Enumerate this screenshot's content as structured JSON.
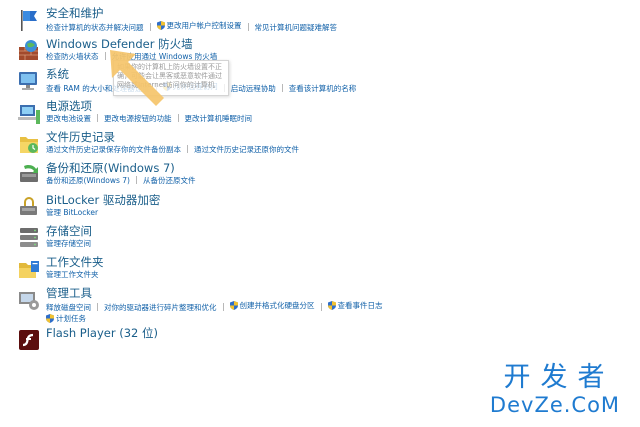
{
  "items": [
    {
      "title": "安全和维护",
      "icon": "flag-icon",
      "links": [
        {
          "label": "检查计算机的状态并解决问题",
          "shield": false
        },
        {
          "label": "更改用户帐户控制设置",
          "shield": true
        },
        {
          "label": "常见计算机问题疑难解答",
          "shield": false
        }
      ]
    },
    {
      "title": "Windows Defender 防火墙",
      "icon": "firewall-icon",
      "links": [
        {
          "label": "检查防火墙状态",
          "shield": false
        },
        {
          "label": "允许应用通过 Windows 防火墙",
          "shield": false
        }
      ]
    },
    {
      "title": "系统",
      "icon": "system-computer-icon",
      "links": [
        {
          "label": "查看 RAM 的大小和处理器速度",
          "shield": false
        },
        {
          "label": "允许远程访问",
          "shield": true
        },
        {
          "label": "启动远程协助",
          "shield": false
        },
        {
          "label": "查看该计算机的名称",
          "shield": false
        }
      ]
    },
    {
      "title": "电源选项",
      "icon": "power-options-icon",
      "links": [
        {
          "label": "更改电池设置",
          "shield": false
        },
        {
          "label": "更改电源按钮的功能",
          "shield": false
        },
        {
          "label": "更改计算机睡眠时间",
          "shield": false
        }
      ]
    },
    {
      "title": "文件历史记录",
      "icon": "file-history-icon",
      "links": [
        {
          "label": "通过文件历史记录保存你的文件备份副本",
          "shield": false
        },
        {
          "label": "通过文件历史记录还原你的文件",
          "shield": false
        }
      ]
    },
    {
      "title": "备份和还原(Windows 7)",
      "icon": "backup-restore-icon",
      "links": [
        {
          "label": "备份和还原(Windows 7)",
          "shield": false
        },
        {
          "label": "从备份还原文件",
          "shield": false
        }
      ]
    },
    {
      "title": "BitLocker 驱动器加密",
      "icon": "bitlocker-icon",
      "links": [
        {
          "label": "管理 BitLocker",
          "shield": false
        }
      ]
    },
    {
      "title": "存储空间",
      "icon": "storage-spaces-icon",
      "links": [
        {
          "label": "管理存储空间",
          "shield": false
        }
      ]
    },
    {
      "title": "工作文件夹",
      "icon": "work-folders-icon",
      "links": [
        {
          "label": "管理工作文件夹",
          "shield": false
        }
      ]
    },
    {
      "title": "管理工具",
      "icon": "admin-tools-icon",
      "links": [
        {
          "label": "释放磁盘空间",
          "shield": false
        },
        {
          "label": "对你的驱动器进行碎片整理和优化",
          "shield": false
        },
        {
          "label": "创建并格式化硬盘分区",
          "shield": true
        },
        {
          "label": "查看事件日志",
          "shield": true
        }
      ],
      "links2": [
        {
          "label": "计划任务",
          "shield": true
        }
      ]
    },
    {
      "title": "Flash Player (32 位)",
      "icon": "flash-player-icon",
      "links": []
    }
  ],
  "tooltip": {
    "text": "如果你的计算机上防火墙设置不正确，可能会让黑客或恶意软件通过网络或Internet访问你的计算机"
  },
  "watermark": {
    "line1": "开发者",
    "line2": "DevZe.CoM"
  },
  "colors": {
    "title": "#1a5e8a",
    "link": "#1060a8",
    "arrow": "#f5c46a",
    "watermark": "#1f7bd0"
  }
}
